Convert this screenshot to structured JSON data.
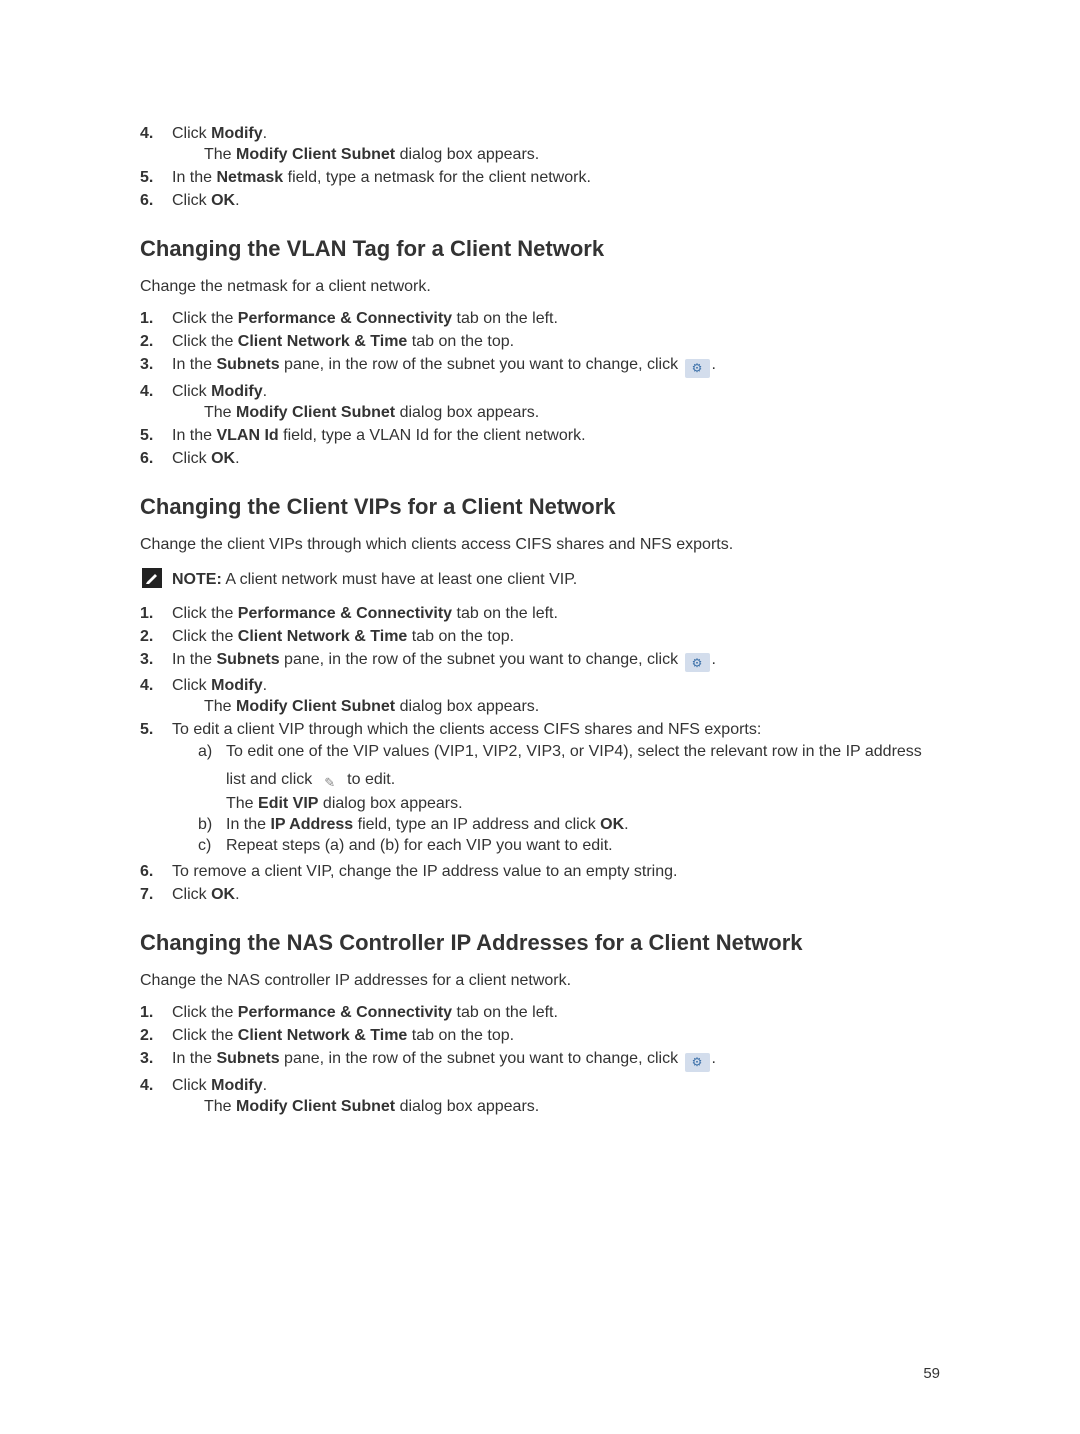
{
  "sec0": {
    "items": [
      {
        "num": "4.",
        "pre": "Click ",
        "b": "Modify",
        "post": ".",
        "sub": "The <strong>Modify Client Subnet</strong> dialog box appears."
      },
      {
        "num": "5.",
        "pre": "In the ",
        "b": "Netmask",
        "post": " field, type a netmask for the client network."
      },
      {
        "num": "6.",
        "pre": "Click ",
        "b": "OK",
        "post": "."
      }
    ]
  },
  "sec1": {
    "heading": "Changing the VLAN Tag for a Client Network",
    "intro": "Change the netmask for a client network.",
    "items": [
      {
        "num": "1.",
        "html": "Click the <strong>Performance &amp; Connectivity</strong> tab on the left."
      },
      {
        "num": "2.",
        "html": "Click the <strong>Client Network &amp; Time</strong> tab on the top."
      },
      {
        "num": "3.",
        "html_pre": "In the <strong>Subnets</strong> pane, in the row of the subnet you want to change, click ",
        "gear": true,
        "post": "."
      },
      {
        "num": "4.",
        "html": "Click <strong>Modify</strong>.",
        "sub": "The <strong>Modify Client Subnet</strong> dialog box appears."
      },
      {
        "num": "5.",
        "html": "In the <strong>VLAN Id</strong> field, type a VLAN Id for the client network."
      },
      {
        "num": "6.",
        "html": "Click <strong>OK</strong>."
      }
    ]
  },
  "sec2": {
    "heading": "Changing the Client VIPs for a Client Network",
    "intro": "Change the client VIPs through which clients access CIFS shares and NFS exports.",
    "note_label": "NOTE:",
    "note": " A client network must have at least one client VIP.",
    "items": [
      {
        "num": "1.",
        "html": "Click the <strong>Performance &amp; Connectivity</strong> tab on the left."
      },
      {
        "num": "2.",
        "html": "Click the <strong>Client Network &amp; Time</strong> tab on the top."
      },
      {
        "num": "3.",
        "html_pre": "In the <strong>Subnets</strong> pane, in the row of the subnet you want to change, click ",
        "gear": true,
        "post": "."
      },
      {
        "num": "4.",
        "html": "Click <strong>Modify</strong>.",
        "sub": "The <strong>Modify Client Subnet</strong> dialog box appears."
      },
      {
        "num": "5.",
        "html": "To edit a client VIP through which the clients access CIFS shares and NFS exports:",
        "alpha": [
          {
            "a": "a)",
            "line1": "To edit one of the VIP values (VIP1, VIP2, VIP3, or VIP4), select the relevant row in the IP address",
            "line2_pre": "list and click ",
            "pencil": true,
            "line2_post": " to edit.",
            "sub": "The <strong>Edit VIP</strong> dialog box appears."
          },
          {
            "a": "b)",
            "html": "In the <strong>IP Address</strong> field, type an IP address and click <strong>OK</strong>."
          },
          {
            "a": "c)",
            "html": "Repeat steps (a) and (b) for each VIP you want to edit."
          }
        ]
      },
      {
        "num": "6.",
        "html": "To remove a client VIP, change the IP address value to an empty string."
      },
      {
        "num": "7.",
        "html": "Click <strong>OK</strong>."
      }
    ]
  },
  "sec3": {
    "heading": "Changing the NAS Controller IP Addresses for a Client Network",
    "intro": "Change the NAS controller IP addresses for a client network.",
    "items": [
      {
        "num": "1.",
        "html": "Click the <strong>Performance &amp; Connectivity</strong> tab on the left."
      },
      {
        "num": "2.",
        "html": "Click the <strong>Client Network &amp; Time</strong> tab on the top."
      },
      {
        "num": "3.",
        "html_pre": "In the <strong>Subnets</strong> pane, in the row of the subnet you want to change, click ",
        "gear": true,
        "post": "."
      },
      {
        "num": "4.",
        "html": "Click <strong>Modify</strong>.",
        "sub": "The <strong>Modify Client Subnet</strong> dialog box appears."
      }
    ]
  },
  "page": "59"
}
